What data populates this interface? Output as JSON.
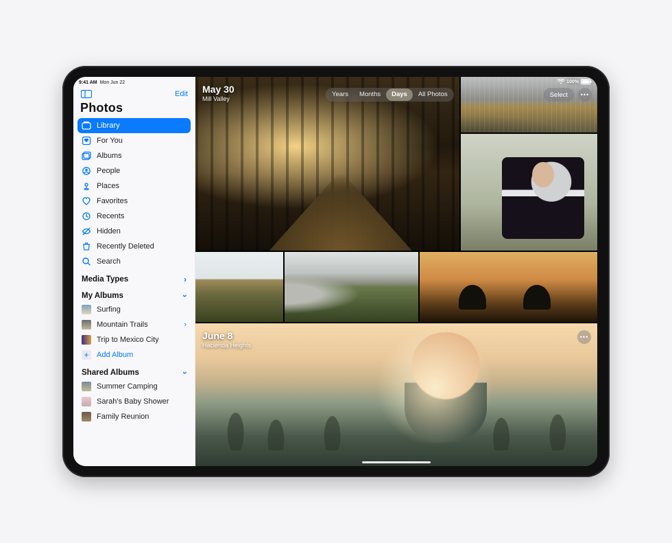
{
  "status": {
    "time": "9:41 AM",
    "date": "Mon Jun 22",
    "wifi": "wifi",
    "battery_pct": "100%"
  },
  "sidebar": {
    "edit": "Edit",
    "title": "Photos",
    "items": [
      {
        "label": "Library",
        "icon": "library-icon"
      },
      {
        "label": "For You",
        "icon": "foryou-icon"
      },
      {
        "label": "Albums",
        "icon": "albums-icon"
      },
      {
        "label": "People",
        "icon": "people-icon"
      },
      {
        "label": "Places",
        "icon": "places-icon"
      },
      {
        "label": "Favorites",
        "icon": "favorites-icon"
      },
      {
        "label": "Recents",
        "icon": "recents-icon"
      },
      {
        "label": "Hidden",
        "icon": "hidden-icon"
      },
      {
        "label": "Recently Deleted",
        "icon": "trash-icon"
      },
      {
        "label": "Search",
        "icon": "search-icon"
      }
    ],
    "sections": {
      "media_types": "Media Types",
      "my_albums": "My Albums",
      "shared_albums": "Shared Albums"
    },
    "my_albums": [
      {
        "label": "Surfing"
      },
      {
        "label": "Mountain Trails",
        "disclosure": true
      },
      {
        "label": "Trip to Mexico City"
      }
    ],
    "add_album": "Add Album",
    "shared_albums": [
      {
        "label": "Summer Camping"
      },
      {
        "label": "Sarah's Baby Shower"
      },
      {
        "label": "Family Reunion"
      }
    ]
  },
  "segmented": {
    "years": "Years",
    "months": "Months",
    "days": "Days",
    "all": "All Photos"
  },
  "controls": {
    "select": "Select",
    "more": "•••"
  },
  "days": [
    {
      "title": "May 30",
      "subtitle": "Mill Valley"
    },
    {
      "title": "June 8",
      "subtitle": "Hacienda Heights"
    }
  ]
}
